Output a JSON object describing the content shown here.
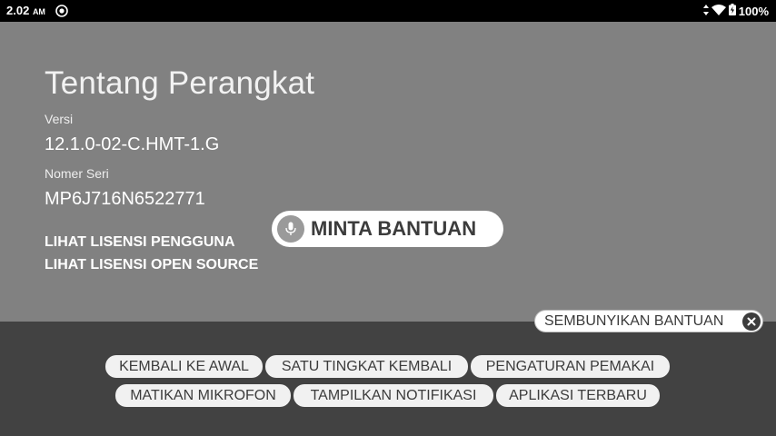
{
  "status_bar": {
    "time": "2.02",
    "ampm": "AM",
    "battery": "100%"
  },
  "about": {
    "title": "Tentang Perangkat",
    "version_label": "Versi",
    "version_value": "12.1.0-02-C.HMT-1.G",
    "serial_label": "Nomer Seri",
    "serial_value": "MP6J716N6522771",
    "link_user_license": "LIHAT LISENSI PENGGUNA",
    "link_open_source": "LIHAT LISENSI OPEN SOURCE"
  },
  "voice_help": {
    "label": "MINTA BANTUAN"
  },
  "hide_help": {
    "label": "SEMBUNYIKAN BANTUAN"
  },
  "commands": {
    "row1": [
      "KEMBALI KE AWAL",
      "SATU TINGKAT KEMBALI",
      "PENGATURAN PEMAKAI"
    ],
    "row2": [
      "MATIKAN MIKROFON",
      "TAMPILKAN NOTIFIKASI",
      "APLIKASI TERBARU"
    ]
  },
  "colors": {
    "status_bar_bg": "#000000",
    "content_bg": "#818181",
    "panel_bg": "#424242",
    "chip_bg": "#f1f1f1"
  }
}
